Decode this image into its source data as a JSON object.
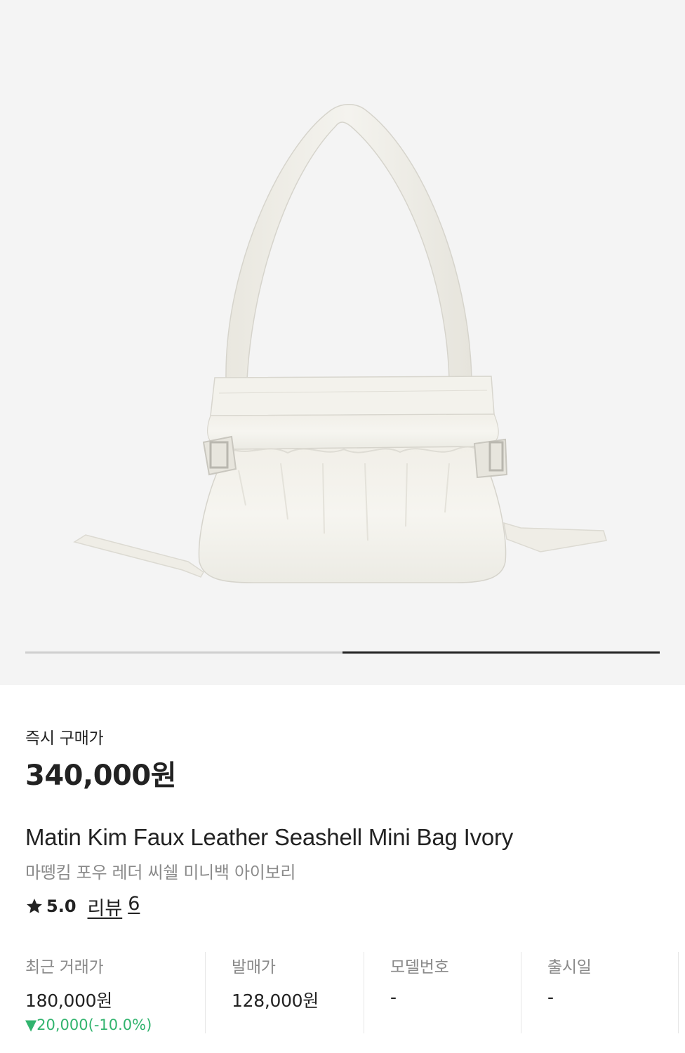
{
  "product": {
    "image_alt": "Matin Kim Faux Leather Seashell Mini Bag Ivory",
    "carousel": {
      "total_pages": 2,
      "current_page": 2
    }
  },
  "price": {
    "label": "즉시 구매가",
    "value": "340,000원"
  },
  "title": {
    "english": "Matin Kim Faux Leather Seashell Mini Bag Ivory",
    "korean": "마뗑킴 포우 레더 씨쉘 미니백 아이보리"
  },
  "rating": {
    "icon": "star-icon",
    "score": "5.0",
    "review_label": "리뷰",
    "review_count": "6"
  },
  "info": {
    "recent_trade": {
      "label": "최근 거래가",
      "value": "180,000원",
      "change": "▼20,000(-10.0%)"
    },
    "release_price": {
      "label": "발매가",
      "value": "128,000원"
    },
    "model_number": {
      "label": "모델번호",
      "value": "-"
    },
    "release_date": {
      "label": "출시일",
      "value": "-"
    }
  },
  "colors": {
    "hero_bg": "#f4f4f4",
    "price_down": "#31b46e",
    "text_primary": "#222222",
    "text_secondary": "#8a8a8a"
  }
}
